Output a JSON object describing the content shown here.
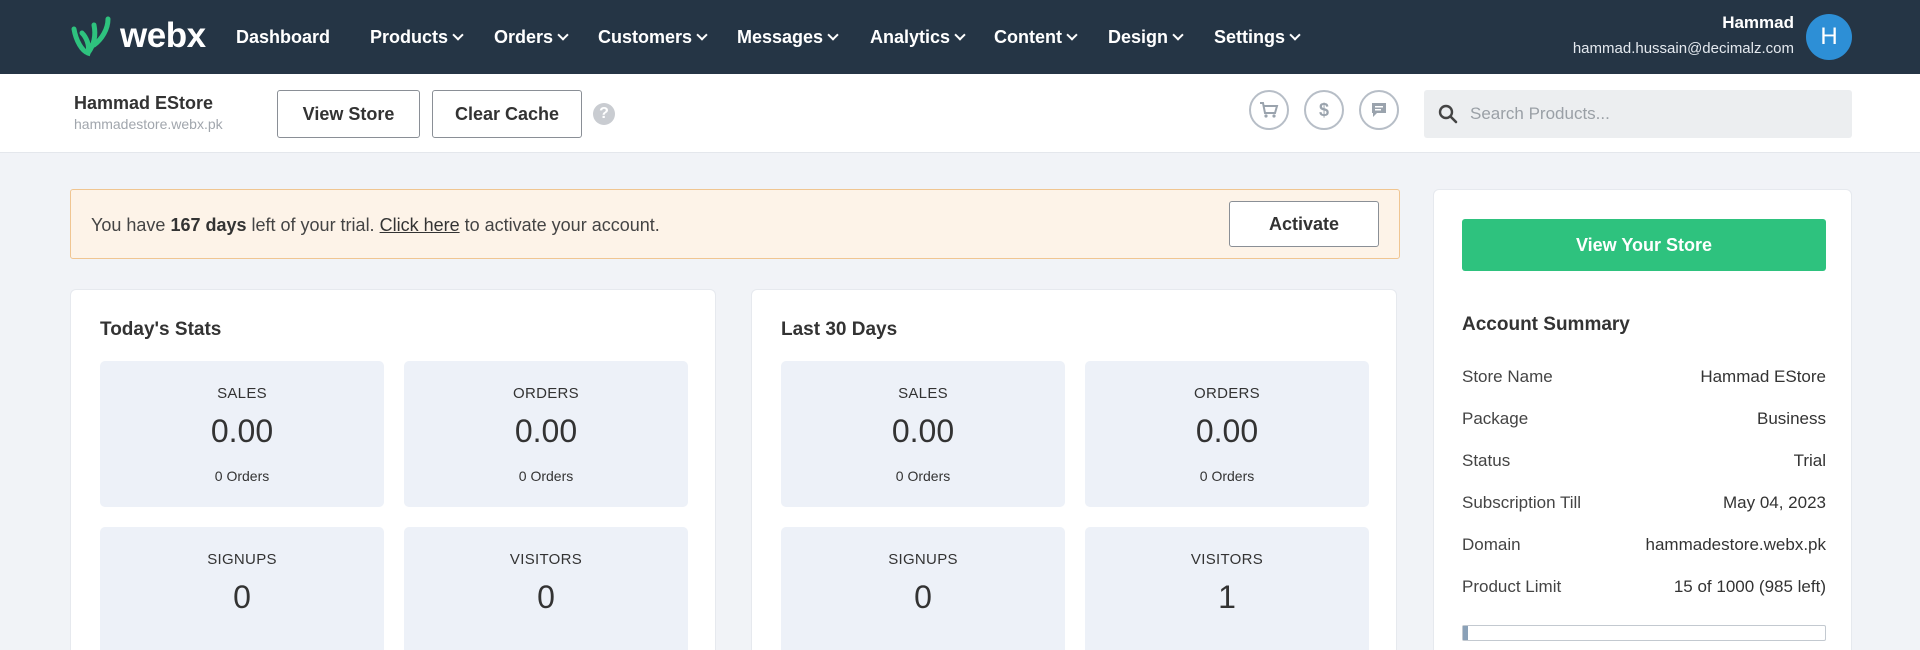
{
  "brand": {
    "name": "webx",
    "logo_color": "#2ec27e"
  },
  "nav": {
    "items": [
      {
        "label": "Dashboard",
        "has_menu": false
      },
      {
        "label": "Products",
        "has_menu": true
      },
      {
        "label": "Orders",
        "has_menu": true
      },
      {
        "label": "Customers",
        "has_menu": true
      },
      {
        "label": "Messages",
        "has_menu": true
      },
      {
        "label": "Analytics",
        "has_menu": true
      },
      {
        "label": "Content",
        "has_menu": true
      },
      {
        "label": "Design",
        "has_menu": true
      },
      {
        "label": "Settings",
        "has_menu": true
      }
    ]
  },
  "user": {
    "name": "Hammad",
    "email": "hammad.hussain@decimalz.com",
    "initial": "H"
  },
  "store": {
    "name": "Hammad EStore",
    "domain": "hammadestore.webx.pk"
  },
  "toolbar": {
    "view_store": "View Store",
    "clear_cache": "Clear Cache",
    "help": "?",
    "icons": [
      "cart-icon",
      "dollar-icon",
      "chat-icon"
    ]
  },
  "search": {
    "placeholder": "Search Products...",
    "value": ""
  },
  "trial": {
    "prefix": "You have",
    "days": "167 days",
    "middle": "left of your trial.",
    "link": "Click here",
    "suffix": "to activate your account.",
    "button": "Activate"
  },
  "today": {
    "title": "Today's Stats",
    "tiles": [
      {
        "label": "SALES",
        "value": "0.00",
        "sub": "0 Orders"
      },
      {
        "label": "ORDERS",
        "value": "0.00",
        "sub": "0 Orders"
      },
      {
        "label": "SIGNUPS",
        "value": "0",
        "sub": ""
      },
      {
        "label": "VISITORS",
        "value": "0",
        "sub": ""
      }
    ]
  },
  "last30": {
    "title": "Last 30 Days",
    "tiles": [
      {
        "label": "SALES",
        "value": "0.00",
        "sub": "0 Orders"
      },
      {
        "label": "ORDERS",
        "value": "0.00",
        "sub": "0 Orders"
      },
      {
        "label": "SIGNUPS",
        "value": "0",
        "sub": ""
      },
      {
        "label": "VISITORS",
        "value": "1",
        "sub": ""
      }
    ]
  },
  "sidebar": {
    "view_store_button": "View Your Store",
    "summary_title": "Account Summary",
    "rows": [
      {
        "key": "Store Name",
        "value": "Hammad EStore"
      },
      {
        "key": "Package",
        "value": "Business"
      },
      {
        "key": "Status",
        "value": "Trial"
      },
      {
        "key": "Subscription Till",
        "value": "May 04, 2023"
      },
      {
        "key": "Domain",
        "value": "hammadestore.webx.pk"
      },
      {
        "key": "Product Limit",
        "value": "15 of 1000 (985 left)"
      }
    ],
    "product_limit_fraction": 0.015
  },
  "colors": {
    "nav_bg": "#253545",
    "accent_green": "#2ec27e",
    "avatar_blue": "#2d8fd6",
    "trial_bg": "#fdf3e8",
    "trial_border": "#f0c591"
  }
}
